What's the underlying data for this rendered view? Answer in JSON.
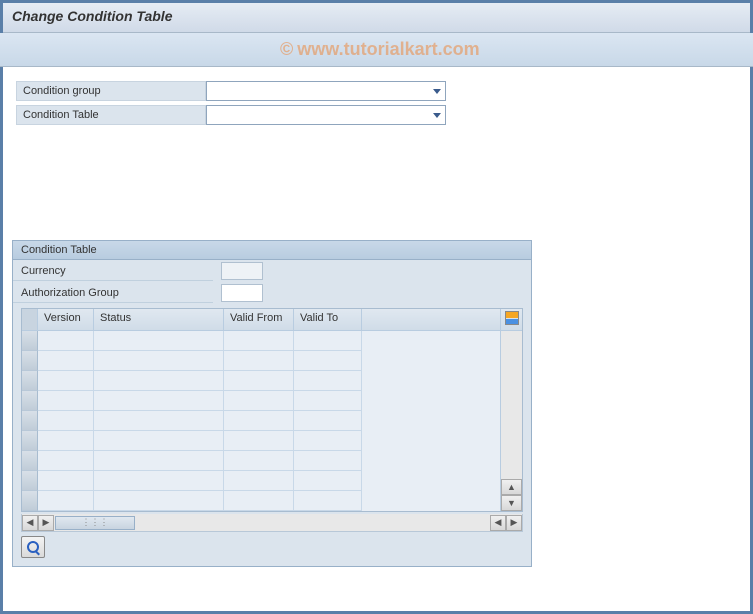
{
  "title": "Change Condition Table",
  "watermark": {
    "symbol": "©",
    "text": "www.tutorialkart.com"
  },
  "topForm": {
    "conditionGroup": {
      "label": "Condition group",
      "value": ""
    },
    "conditionTable": {
      "label": "Condition Table",
      "value": ""
    }
  },
  "panel": {
    "title": "Condition Table",
    "currency": {
      "label": "Currency",
      "value": ""
    },
    "authGroup": {
      "label": "Authorization Group",
      "value": ""
    }
  },
  "grid": {
    "columns": {
      "version": "Version",
      "status": "Status",
      "validFrom": "Valid From",
      "validTo": "Valid To"
    },
    "rows": [
      {
        "version": "",
        "status": "",
        "validFrom": "",
        "validTo": ""
      },
      {
        "version": "",
        "status": "",
        "validFrom": "",
        "validTo": ""
      },
      {
        "version": "",
        "status": "",
        "validFrom": "",
        "validTo": ""
      },
      {
        "version": "",
        "status": "",
        "validFrom": "",
        "validTo": ""
      },
      {
        "version": "",
        "status": "",
        "validFrom": "",
        "validTo": ""
      },
      {
        "version": "",
        "status": "",
        "validFrom": "",
        "validTo": ""
      },
      {
        "version": "",
        "status": "",
        "validFrom": "",
        "validTo": ""
      },
      {
        "version": "",
        "status": "",
        "validFrom": "",
        "validTo": ""
      },
      {
        "version": "",
        "status": "",
        "validFrom": "",
        "validTo": ""
      }
    ]
  },
  "icons": {
    "settings": "table-settings-icon",
    "detail": "magnifier-icon"
  }
}
